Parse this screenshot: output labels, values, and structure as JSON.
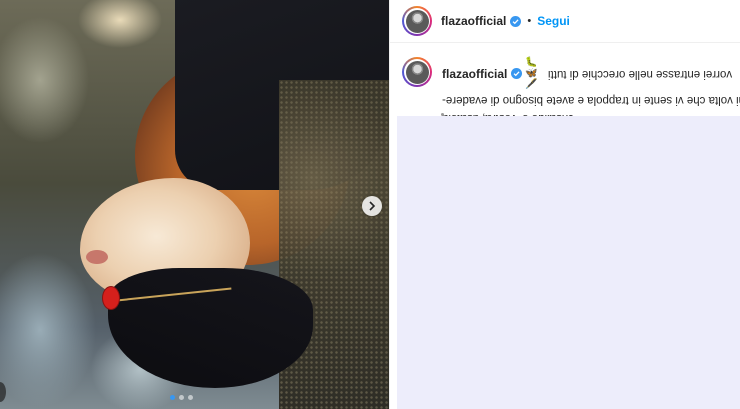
{
  "post": {
    "username": "flazaofficial",
    "follow_label": "Segui",
    "bullet": "•",
    "caption_emojis": "🐛🦋🖋️",
    "caption_line1": "vorrei entrasse nelle orecchie di tutti",
    "caption_line2": "ogni volta che vi sente in trappola e avete bisogno di evadere-",
    "caption_line3": "crisalide e' vostra, usatela"
  },
  "carousel": {
    "total": 3,
    "active": 1
  },
  "icons": [
    "verified-badge-icon",
    "chevron-right-icon"
  ],
  "colors": {
    "link": "#0095f6",
    "verified": "#3897f0",
    "comments_placeholder": "#ededfb"
  }
}
